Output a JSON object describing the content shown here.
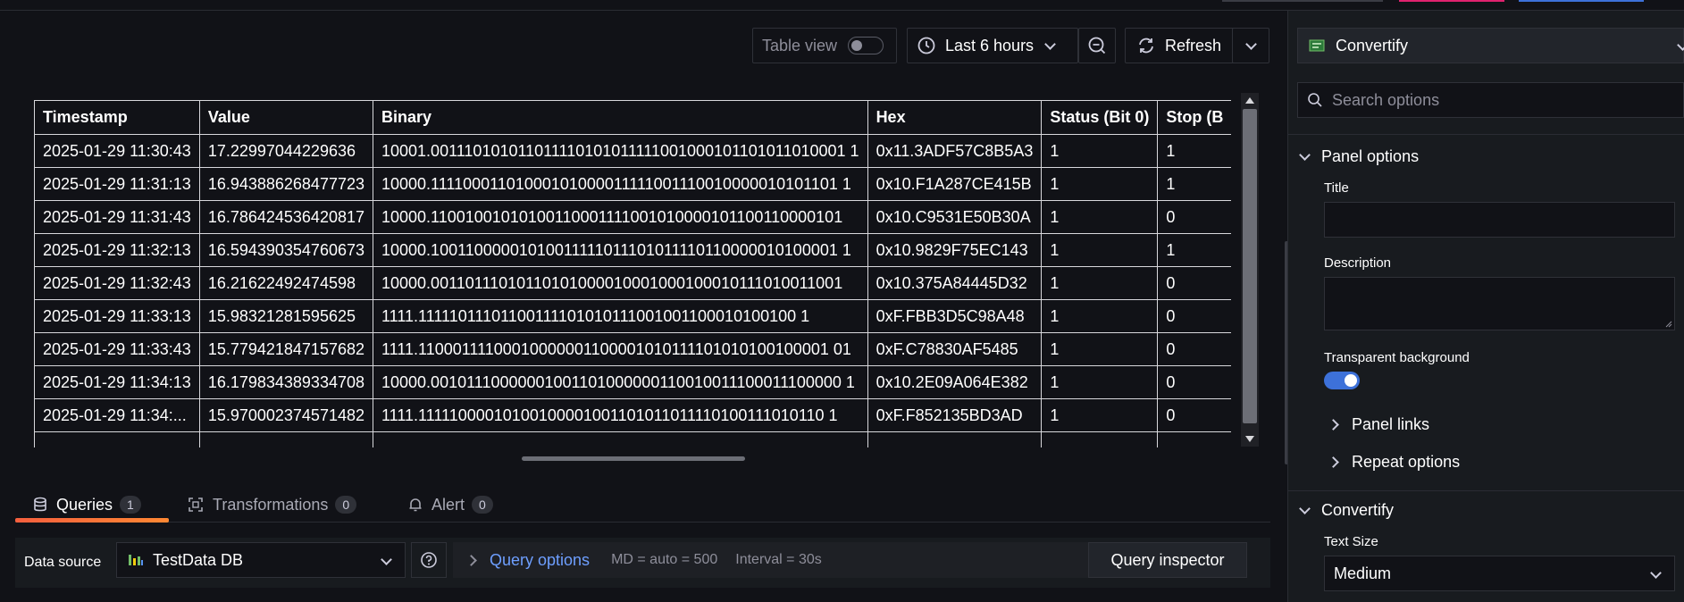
{
  "toolbar": {
    "table_view_label": "Table view",
    "time_range": "Last 6 hours",
    "refresh_label": "Refresh"
  },
  "table": {
    "columns": [
      "Timestamp",
      "Value",
      "Binary",
      "Hex",
      "Status (Bit 0)",
      "Stop (B"
    ],
    "rows": [
      [
        "2025-01-29 11:30:43",
        "17.22997044229636",
        "10001.001110101011011110101011111001000101101011010001 1",
        "0x11.3ADF57C8B5A3",
        "1",
        "1"
      ],
      [
        "2025-01-29 11:31:13",
        "16.943886268477723",
        "10000.11110001101000101000011111001110010000010101101 1",
        "0x10.F1A287CE415B",
        "1",
        "1"
      ],
      [
        "2025-01-29 11:31:43",
        "16.786424536420817",
        "10000.11001001010100110001111001010000101100110000101",
        "0x10.C9531E50B30A",
        "1",
        "0"
      ],
      [
        "2025-01-29 11:32:13",
        "16.594390354760673",
        "10000.10011000001010011111011101011110110000010100001 1",
        "0x10.9829F75EC143",
        "1",
        "1"
      ],
      [
        "2025-01-29 11:32:43",
        "16.21622492474598",
        "10000.00110111010110101000010001000100010111010011001",
        "0x10.375A84445D32",
        "1",
        "0"
      ],
      [
        "2025-01-29 11:33:13",
        "15.98321281595625",
        "1111.11111011101100111101010111001001100010100100 1",
        "0xF.FBB3D5C98A48",
        "1",
        "0"
      ],
      [
        "2025-01-29 11:33:43",
        "15.779421847157682",
        "1111.11000111100010000001100001010111101010100100001 01",
        "0xF.C78830AF5485",
        "1",
        "0"
      ],
      [
        "2025-01-29 11:34:13",
        "16.179834389334708",
        "10000.00101110000001001101000000110010011100011100000 1",
        "0x10.2E09A064E382",
        "1",
        "0"
      ],
      [
        "2025-01-29 11:34:...",
        "15.970002374571482",
        "1111.11111000010100100001001101011011110100111010110 1",
        "0xF.F852135BD3AD",
        "1",
        "0"
      ]
    ]
  },
  "tabs": [
    {
      "label": "Queries",
      "count": "1"
    },
    {
      "label": "Transformations",
      "count": "0"
    },
    {
      "label": "Alert",
      "count": "0"
    }
  ],
  "query": {
    "datasource_label": "Data source",
    "datasource": "TestData DB",
    "options_label": "Query options",
    "md": "MD = auto = 500",
    "interval": "Interval = 30s",
    "inspector_label": "Query inspector"
  },
  "right_panel": {
    "visualization": "Convertify",
    "search_placeholder": "Search options",
    "panel_options": "Panel options",
    "title_label": "Title",
    "description_label": "Description",
    "transparent_label": "Transparent background",
    "panel_links": "Panel links",
    "repeat_options": "Repeat options",
    "convertify_section": "Convertify",
    "text_size_label": "Text Size",
    "text_size_value": "Medium"
  },
  "colors": {
    "background": "#111217",
    "panel": "#181b1f",
    "accent_blue": "#3d71d9",
    "link_blue": "#6e9fff",
    "tab_underline": "#f55f3e"
  }
}
